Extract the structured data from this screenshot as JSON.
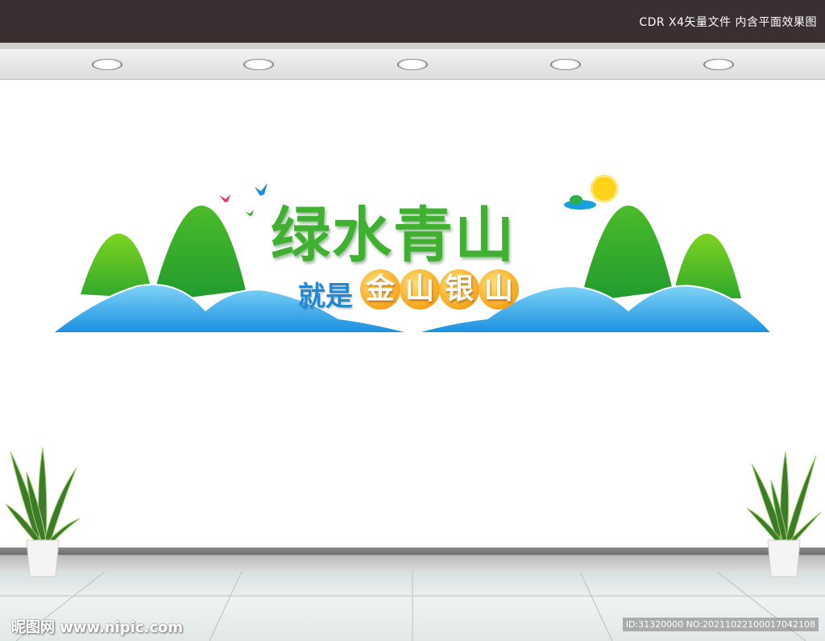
{
  "header": {
    "label": "CDR X4矢量文件  内含平面效果图"
  },
  "slogan": {
    "main": "绿水青山",
    "prefix": "就是",
    "highlight": [
      "金",
      "山",
      "银",
      "山"
    ]
  },
  "watermarks": {
    "left": "昵图网 www.nipic.com",
    "right": "ID:31320000 NO:20211022100017042108"
  },
  "colors": {
    "mountain_green": "#3fb02f",
    "water_blue": "#2aa4e3",
    "sun_yellow": "#ffd21a",
    "highlight_orange": "#f7a51c",
    "prefix_blue": "#1e88d8"
  },
  "icons": [
    "sun-icon",
    "cloud-icon",
    "bird-icon",
    "plant-icon",
    "ceiling-light-icon"
  ]
}
